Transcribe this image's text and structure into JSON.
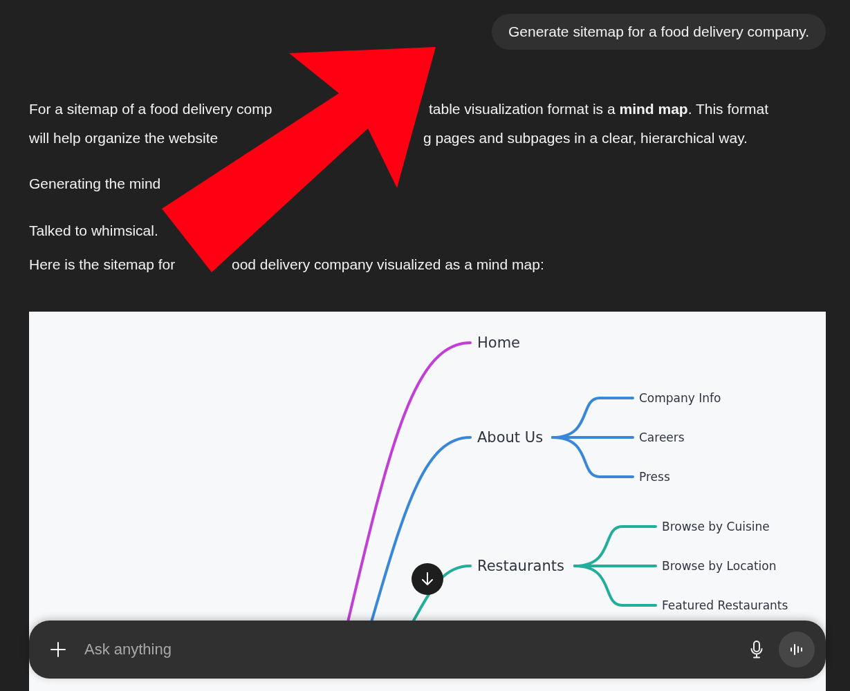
{
  "user_message": {
    "text": "Generate sitemap for a food delivery company."
  },
  "response": {
    "lines": [
      {
        "fragments": [
          "For a sitemap of a food delivery comp",
          "table visualization format is a **mind map**. This format"
        ]
      },
      {
        "fragments": [
          "will help organize the website",
          "g pages and subpages in a clear, hierarchical way."
        ]
      },
      {
        "fragments": [
          "Generating the mind"
        ]
      },
      {
        "fragments": [
          "Talked to whimsical."
        ]
      },
      {
        "fragments": [
          "Here is the sitemap for",
          "ood delivery company visualized as a mind map:"
        ]
      }
    ]
  },
  "mind_map": {
    "branches": [
      {
        "label": "Home",
        "color": "#c23fd6"
      },
      {
        "label": "About Us",
        "color": "#3a87d8",
        "children": [
          {
            "label": "Company Info"
          },
          {
            "label": "Careers"
          },
          {
            "label": "Press"
          }
        ]
      },
      {
        "label": "Restaurants",
        "color": "#22ae9a",
        "children": [
          {
            "label": "Browse by Cuisine"
          },
          {
            "label": "Browse by Location"
          },
          {
            "label": "Featured Restaurants"
          }
        ]
      }
    ]
  },
  "composer": {
    "placeholder": "Ask anything"
  }
}
